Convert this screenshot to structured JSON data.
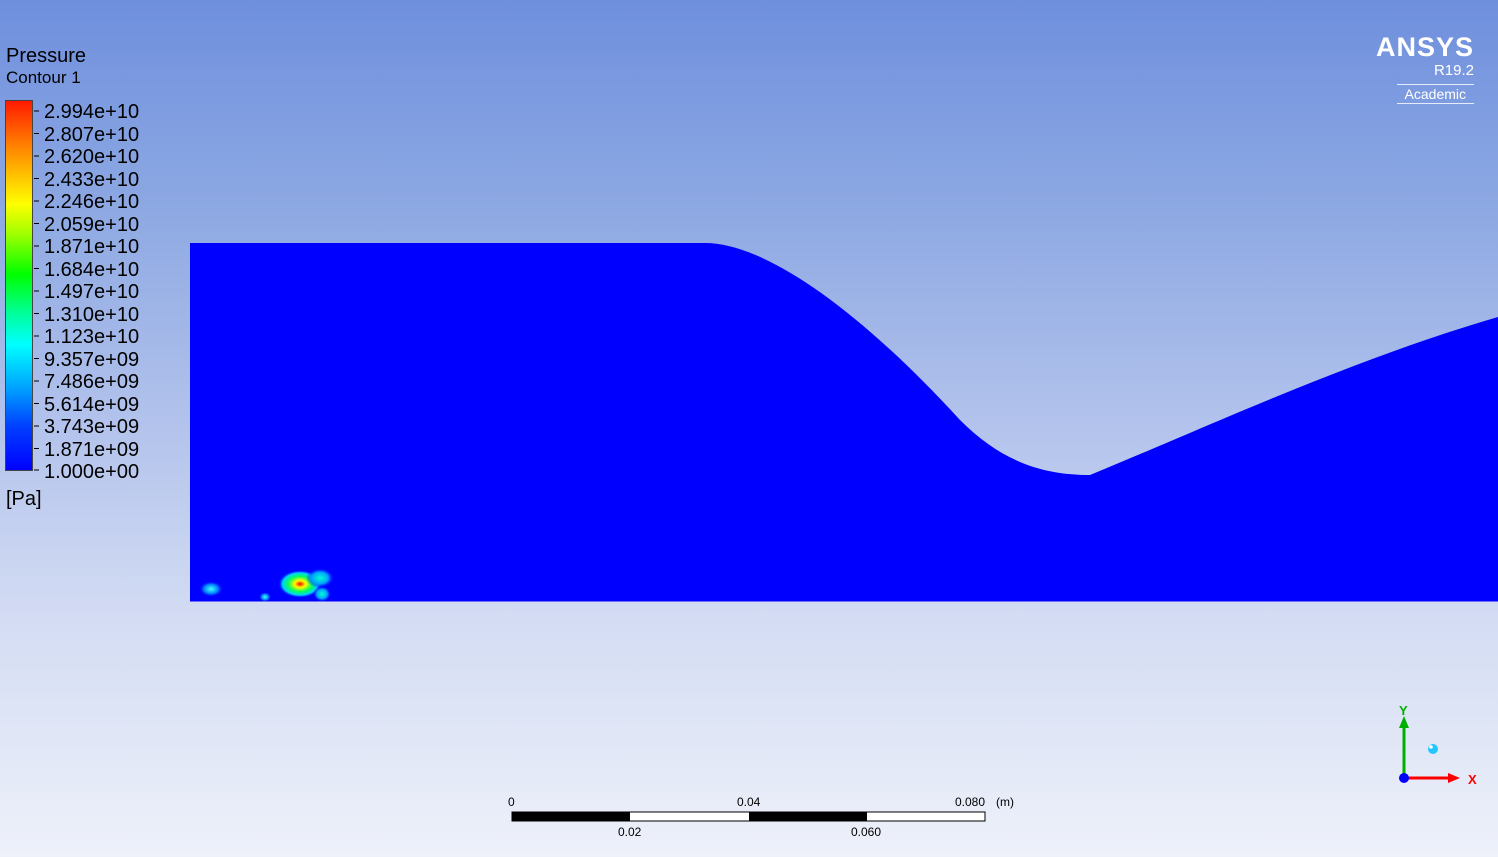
{
  "legend": {
    "title": "Pressure",
    "subtitle": "Contour 1",
    "unit": "[Pa]",
    "labels": [
      "2.994e+10",
      "2.807e+10",
      "2.620e+10",
      "2.433e+10",
      "2.246e+10",
      "2.059e+10",
      "1.871e+10",
      "1.684e+10",
      "1.497e+10",
      "1.310e+10",
      "1.123e+10",
      "9.357e+09",
      "7.486e+09",
      "5.614e+09",
      "3.743e+09",
      "1.871e+09",
      "1.000e+00"
    ],
    "colors": [
      "#ff0000",
      "#ff8800",
      "#ffff00",
      "#00ff00",
      "#00ffff",
      "#0000ff"
    ]
  },
  "logo": {
    "brand": "ANSYS",
    "version": "R19.2",
    "edition": "Academic"
  },
  "scale": {
    "top_labels": [
      "0",
      "0.04",
      "0.080"
    ],
    "bottom_labels": [
      "0.02",
      "0.060"
    ],
    "unit": "(m)"
  },
  "triad": {
    "x_label": "X",
    "y_label": "Y",
    "x_color": "#ff0000",
    "y_color": "#00b000",
    "z_color": "#0000ff"
  },
  "domain_color": "#0000ff"
}
